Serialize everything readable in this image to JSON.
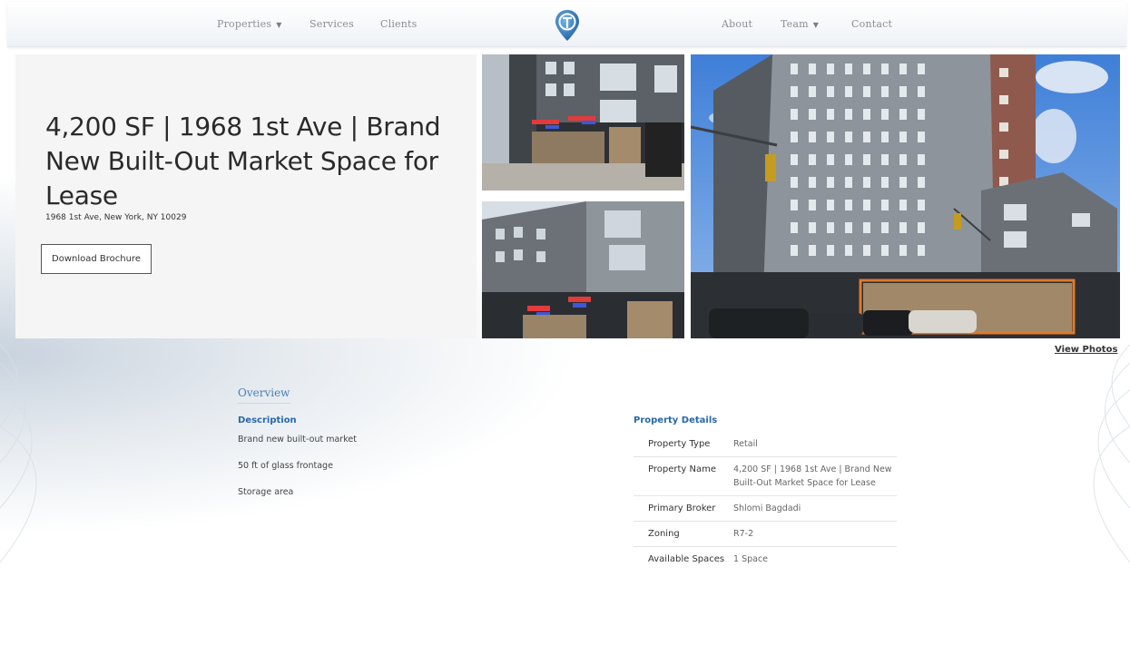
{
  "nav": {
    "left_items": [
      {
        "label": "Properties",
        "dropdown": true
      },
      {
        "label": "Services",
        "dropdown": false
      },
      {
        "label": "Clients",
        "dropdown": false
      }
    ],
    "right_items": [
      {
        "label": "About",
        "dropdown": false
      },
      {
        "label": "Team",
        "dropdown": true
      },
      {
        "label": "Contact",
        "dropdown": false
      }
    ],
    "caret": "▼",
    "logo_icon": "pin-logo-icon"
  },
  "hero": {
    "title": "4,200 SF | 1968 1st Ave | Brand New Built-Out Market Space for Lease",
    "address": "1968 1st Ave, New York, NY 10029",
    "brochure_label": "Download Brochure",
    "view_photos_label": "View Photos"
  },
  "overview": {
    "tab_label": "Overview",
    "description_heading": "Description",
    "description_items": [
      "Brand new built-out market",
      "50 ft of glass frontage",
      "Storage area"
    ],
    "details_heading": "Property Details",
    "details": [
      {
        "label": "Property Type",
        "value": "Retail"
      },
      {
        "label": "Property Name",
        "value": "4,200 SF | 1968 1st Ave | Brand New Built-Out Market Space for Lease"
      },
      {
        "label": "Primary Broker",
        "value": "Shlomi Bagdadi"
      },
      {
        "label": "Zoning",
        "value": "R7-2"
      },
      {
        "label": "Available Spaces",
        "value": "1 Space"
      }
    ]
  },
  "colors": {
    "accent": "#2868a8",
    "logo_blue": "#2f7fc4",
    "highlight_box": "#e07a2a"
  }
}
